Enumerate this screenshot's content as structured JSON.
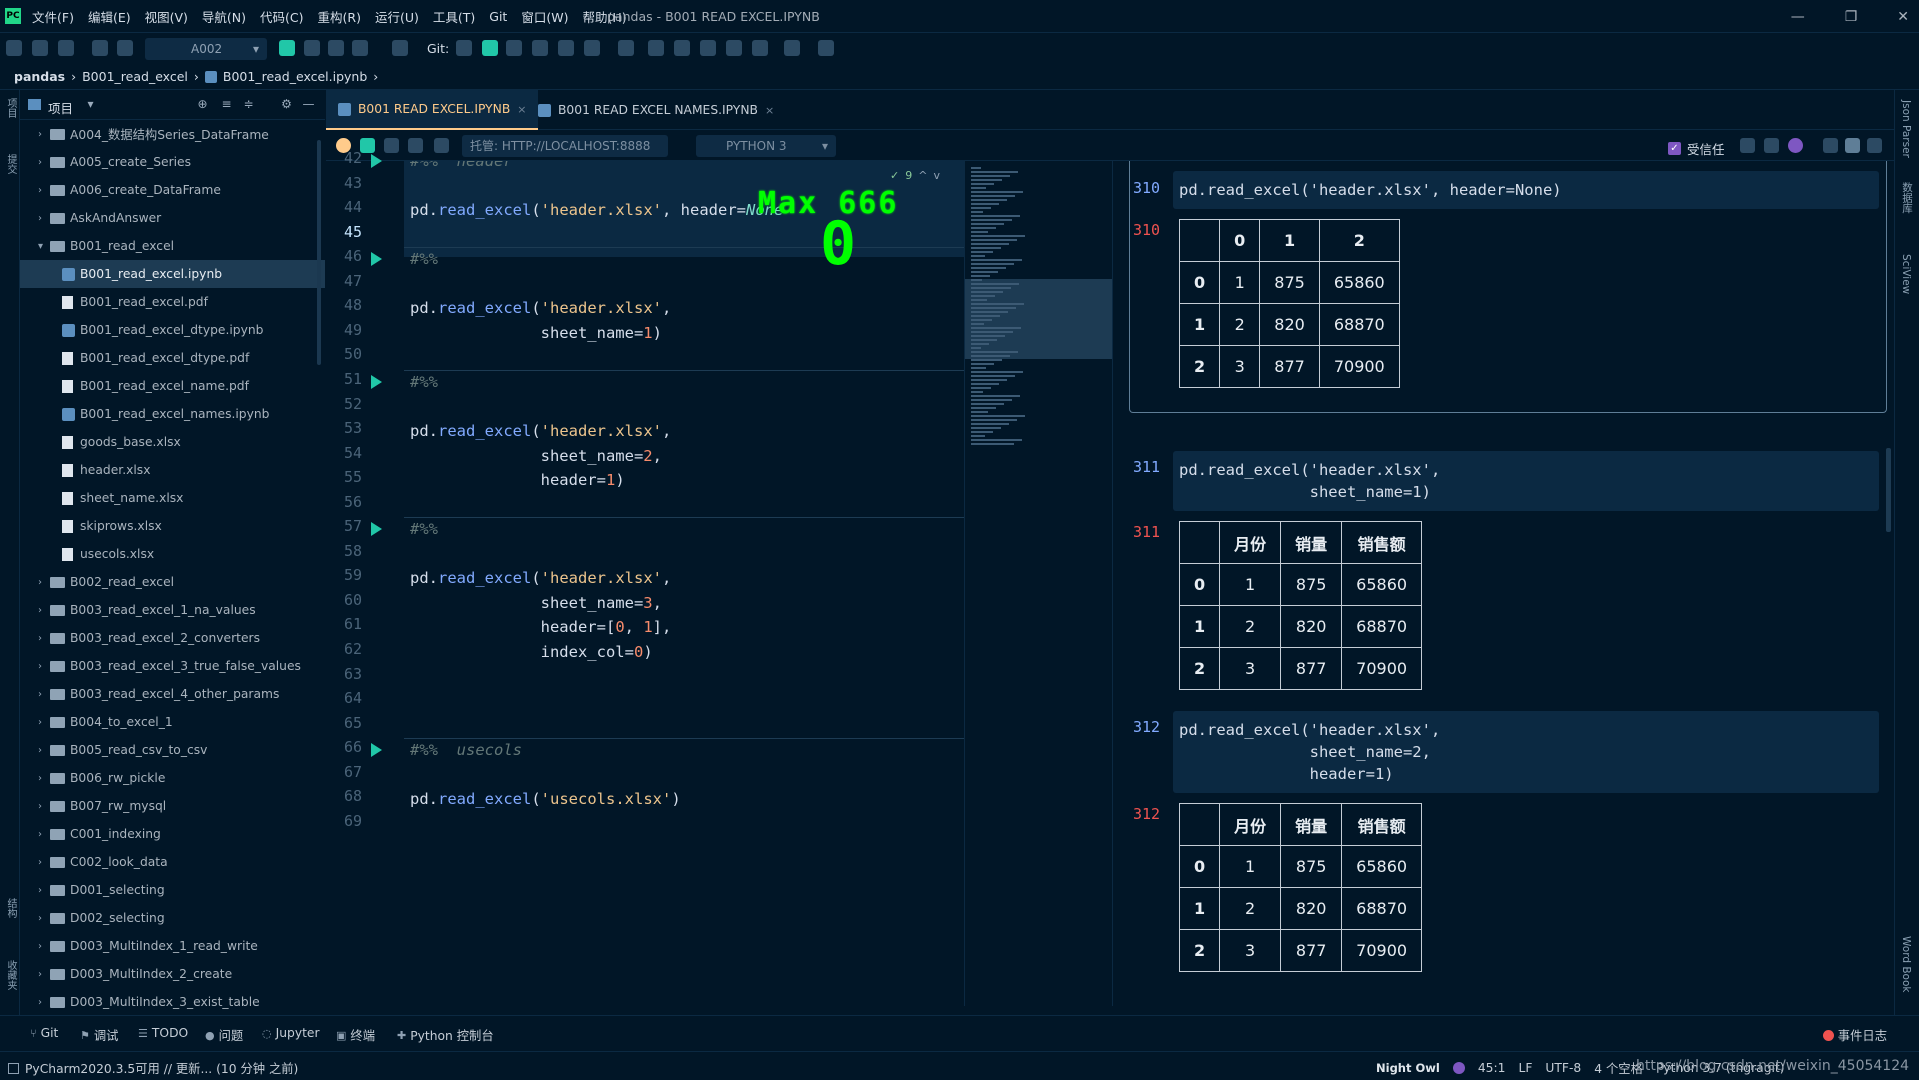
{
  "window": {
    "title": "pandas - B001 READ EXCEL.IPYNB",
    "menus": [
      "文件(F)",
      "编辑(E)",
      "视图(V)",
      "导航(N)",
      "代码(C)",
      "重构(R)",
      "运行(U)",
      "工具(T)",
      "Git",
      "窗口(W)",
      "帮助(H)"
    ],
    "logo": "PC",
    "controls": {
      "minimize": "—",
      "restore": "❐",
      "close": "✕"
    }
  },
  "toolbar": {
    "run_config": "A002",
    "git_label": "Git:"
  },
  "breadcrumb": [
    "pandas",
    "B001_read_excel",
    "B001_read_excel.ipynb"
  ],
  "left_strip": {
    "project": "项目",
    "commit": "提交",
    "structure": "结构",
    "favorites": "收藏夹"
  },
  "project_panel": {
    "title": "项目",
    "items": [
      {
        "label": "A004_数据结构Series_DataFrame",
        "type": "folder",
        "depth": 1,
        "expanded": false
      },
      {
        "label": "A005_create_Series",
        "type": "folder",
        "depth": 1,
        "expanded": false
      },
      {
        "label": "A006_create_DataFrame",
        "type": "folder",
        "depth": 1,
        "expanded": false
      },
      {
        "label": "AskAndAnswer",
        "type": "folder",
        "depth": 1,
        "expanded": false
      },
      {
        "label": "B001_read_excel",
        "type": "folder",
        "depth": 1,
        "expanded": true
      },
      {
        "label": "B001_read_excel.ipynb",
        "type": "notebook",
        "depth": 2,
        "selected": true
      },
      {
        "label": "B001_read_excel.pdf",
        "type": "file",
        "depth": 2
      },
      {
        "label": "B001_read_excel_dtype.ipynb",
        "type": "notebook",
        "depth": 2
      },
      {
        "label": "B001_read_excel_dtype.pdf",
        "type": "file",
        "depth": 2
      },
      {
        "label": "B001_read_excel_name.pdf",
        "type": "file",
        "depth": 2
      },
      {
        "label": "B001_read_excel_names.ipynb",
        "type": "notebook",
        "depth": 2
      },
      {
        "label": "goods_base.xlsx",
        "type": "file",
        "depth": 2
      },
      {
        "label": "header.xlsx",
        "type": "file",
        "depth": 2
      },
      {
        "label": "sheet_name.xlsx",
        "type": "file",
        "depth": 2
      },
      {
        "label": "skiprows.xlsx",
        "type": "file",
        "depth": 2
      },
      {
        "label": "usecols.xlsx",
        "type": "file",
        "depth": 2
      },
      {
        "label": "B002_read_excel",
        "type": "folder",
        "depth": 1,
        "expanded": false
      },
      {
        "label": "B003_read_excel_1_na_values",
        "type": "folder",
        "depth": 1,
        "expanded": false
      },
      {
        "label": "B003_read_excel_2_converters",
        "type": "folder",
        "depth": 1,
        "expanded": false
      },
      {
        "label": "B003_read_excel_3_true_false_values",
        "type": "folder",
        "depth": 1,
        "expanded": false
      },
      {
        "label": "B003_read_excel_4_other_params",
        "type": "folder",
        "depth": 1,
        "expanded": false
      },
      {
        "label": "B004_to_excel_1",
        "type": "folder",
        "depth": 1,
        "expanded": false
      },
      {
        "label": "B005_read_csv_to_csv",
        "type": "folder",
        "depth": 1,
        "expanded": false
      },
      {
        "label": "B006_rw_pickle",
        "type": "folder",
        "depth": 1,
        "expanded": false
      },
      {
        "label": "B007_rw_mysql",
        "type": "folder",
        "depth": 1,
        "expanded": false
      },
      {
        "label": "C001_indexing",
        "type": "folder",
        "depth": 1,
        "expanded": false
      },
      {
        "label": "C002_look_data",
        "type": "folder",
        "depth": 1,
        "expanded": false
      },
      {
        "label": "D001_selecting",
        "type": "folder",
        "depth": 1,
        "expanded": false
      },
      {
        "label": "D002_selecting",
        "type": "folder",
        "depth": 1,
        "expanded": false
      },
      {
        "label": "D003_MultiIndex_1_read_write",
        "type": "folder",
        "depth": 1,
        "expanded": false
      },
      {
        "label": "D003_MultiIndex_2_create",
        "type": "folder",
        "depth": 1,
        "expanded": false
      },
      {
        "label": "D003_MultiIndex_3_exist_table",
        "type": "folder",
        "depth": 1,
        "expanded": false
      }
    ]
  },
  "tabs": [
    {
      "label": "B001 READ EXCEL.IPYNB",
      "active": true,
      "close": "×"
    },
    {
      "label": "B001 READ EXCEL NAMES.IPYNB",
      "active": false,
      "close": "×"
    }
  ],
  "notebook_toolbar": {
    "kernel_label": "托管: HTTP://LOCALHOST:8888",
    "interpreter": "PYTHON 3",
    "trusted": "受信任"
  },
  "inspection": {
    "count": "9"
  },
  "overlay": {
    "max_text": "Max 666",
    "big_text": "0"
  },
  "editor": {
    "lines": [
      {
        "n": "42",
        "run": true,
        "tokens": [
          [
            "c",
            "#%%  header"
          ]
        ]
      },
      {
        "n": "43",
        "run": false,
        "tokens": []
      },
      {
        "n": "44",
        "run": false,
        "tokens": [
          [
            "p",
            "pd."
          ],
          [
            "f",
            "read_excel"
          ],
          [
            "p",
            "("
          ],
          [
            "s",
            "'header.xlsx'"
          ],
          [
            "p",
            ", header="
          ],
          [
            "none",
            "None"
          ]
        ]
      },
      {
        "n": "45",
        "run": false,
        "current": true,
        "tokens": []
      },
      {
        "n": "46",
        "run": true,
        "tokens": [
          [
            "c",
            "#%%"
          ]
        ]
      },
      {
        "n": "47",
        "run": false,
        "tokens": []
      },
      {
        "n": "48",
        "run": false,
        "tokens": [
          [
            "p",
            "pd."
          ],
          [
            "f",
            "read_excel"
          ],
          [
            "p",
            "("
          ],
          [
            "s",
            "'header.xlsx'"
          ],
          [
            "p",
            ","
          ]
        ]
      },
      {
        "n": "49",
        "run": false,
        "tokens": [
          [
            "p",
            "              sheet_name="
          ],
          [
            "n",
            "1"
          ],
          [
            "p",
            ")"
          ]
        ]
      },
      {
        "n": "50",
        "run": false,
        "tokens": []
      },
      {
        "n": "51",
        "run": true,
        "tokens": [
          [
            "c",
            "#%%"
          ]
        ]
      },
      {
        "n": "52",
        "run": false,
        "tokens": []
      },
      {
        "n": "53",
        "run": false,
        "tokens": [
          [
            "p",
            "pd."
          ],
          [
            "f",
            "read_excel"
          ],
          [
            "p",
            "("
          ],
          [
            "s",
            "'header.xlsx'"
          ],
          [
            "p",
            ","
          ]
        ]
      },
      {
        "n": "54",
        "run": false,
        "tokens": [
          [
            "p",
            "              sheet_name="
          ],
          [
            "n",
            "2"
          ],
          [
            "p",
            ","
          ]
        ]
      },
      {
        "n": "55",
        "run": false,
        "tokens": [
          [
            "p",
            "              header="
          ],
          [
            "n",
            "1"
          ],
          [
            "p",
            ")"
          ]
        ]
      },
      {
        "n": "56",
        "run": false,
        "tokens": []
      },
      {
        "n": "57",
        "run": true,
        "tokens": [
          [
            "c",
            "#%%"
          ]
        ]
      },
      {
        "n": "58",
        "run": false,
        "tokens": []
      },
      {
        "n": "59",
        "run": false,
        "tokens": [
          [
            "p",
            "pd."
          ],
          [
            "f",
            "read_excel"
          ],
          [
            "p",
            "("
          ],
          [
            "s",
            "'header.xlsx'"
          ],
          [
            "p",
            ","
          ]
        ]
      },
      {
        "n": "60",
        "run": false,
        "tokens": [
          [
            "p",
            "              sheet_name="
          ],
          [
            "n",
            "3"
          ],
          [
            "p",
            ","
          ]
        ]
      },
      {
        "n": "61",
        "run": false,
        "tokens": [
          [
            "p",
            "              header=["
          ],
          [
            "n",
            "0"
          ],
          [
            "p",
            ", "
          ],
          [
            "n",
            "1"
          ],
          [
            "p",
            "],"
          ]
        ]
      },
      {
        "n": "62",
        "run": false,
        "tokens": [
          [
            "p",
            "              index_col="
          ],
          [
            "n",
            "0"
          ],
          [
            "p",
            ")"
          ]
        ]
      },
      {
        "n": "63",
        "run": false,
        "tokens": []
      },
      {
        "n": "64",
        "run": false,
        "tokens": []
      },
      {
        "n": "65",
        "run": false,
        "tokens": []
      },
      {
        "n": "66",
        "run": true,
        "tokens": [
          [
            "c",
            "#%%  usecols"
          ]
        ]
      },
      {
        "n": "67",
        "run": false,
        "tokens": []
      },
      {
        "n": "68",
        "run": false,
        "tokens": [
          [
            "p",
            "pd."
          ],
          [
            "f",
            "read_excel"
          ],
          [
            "p",
            "("
          ],
          [
            "s",
            "'usecols.xlsx'"
          ],
          [
            "p",
            ")"
          ]
        ]
      },
      {
        "n": "69",
        "run": false,
        "tokens": []
      }
    ]
  },
  "output": {
    "cells": [
      {
        "in": "310",
        "code": "pd.read_excel('header.xlsx', header=None)",
        "out": "310",
        "columns": [
          "",
          "0",
          "1",
          "2"
        ],
        "rows": [
          [
            "0",
            "1",
            "875",
            "65860"
          ],
          [
            "1",
            "2",
            "820",
            "68870"
          ],
          [
            "2",
            "3",
            "877",
            "70900"
          ]
        ]
      },
      {
        "in": "311",
        "code": "pd.read_excel('header.xlsx',\n              sheet_name=1)",
        "out": "311",
        "columns": [
          "",
          "月份",
          "销量",
          "销售额"
        ],
        "rows": [
          [
            "0",
            "1",
            "875",
            "65860"
          ],
          [
            "1",
            "2",
            "820",
            "68870"
          ],
          [
            "2",
            "3",
            "877",
            "70900"
          ]
        ]
      },
      {
        "in": "312",
        "code": "pd.read_excel('header.xlsx',\n              sheet_name=2,\n              header=1)",
        "out": "312",
        "columns": [
          "",
          "月份",
          "销量",
          "销售额"
        ],
        "rows": [
          [
            "0",
            "1",
            "875",
            "65860"
          ],
          [
            "1",
            "2",
            "820",
            "68870"
          ],
          [
            "2",
            "3",
            "877",
            "70900"
          ]
        ]
      }
    ]
  },
  "right_strip": [
    "Json Parser",
    "数据库",
    "SciView",
    "Word Book"
  ],
  "bottom_tools": [
    "Git",
    "调试",
    "TODO",
    "问题",
    "Jupyter",
    "终端",
    "Python 控制台"
  ],
  "event_log": "事件日志",
  "status": {
    "message": "PyCharm2020.3.5可用 // 更新... (10 分钟 之前)",
    "theme": "Night Owl",
    "position": "45:1",
    "line_sep": "LF",
    "encoding": "UTF-8",
    "indent": "4 个空格",
    "interpreter": "Python 3.7 (tngragit)",
    "watermark": "https://blog.csdn.net/weixin_45054124"
  },
  "colors": {
    "background": "#011627",
    "accent": "#ffcb8b",
    "selection": "#1d3b53",
    "overlay_text": "#00ff00"
  }
}
